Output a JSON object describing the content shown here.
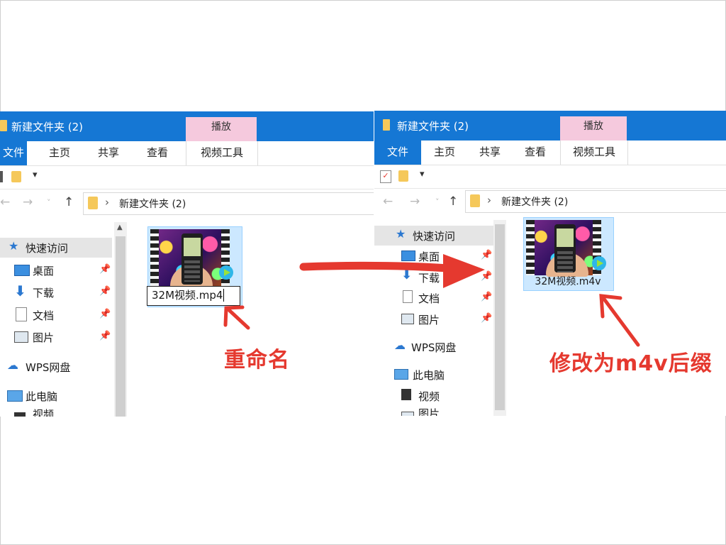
{
  "left_window": {
    "title": "新建文件夹 (2)",
    "context_tab": "播放",
    "ribbon_tabs": [
      "文件",
      "主页",
      "共享",
      "查看",
      "视频工具"
    ],
    "address_path": "新建文件夹 (2)",
    "nav_items": [
      {
        "label": "快速访问",
        "icon": "star-icon"
      },
      {
        "label": "桌面",
        "icon": "desktop-icon",
        "pinned": true
      },
      {
        "label": "下载",
        "icon": "download-icon",
        "pinned": true
      },
      {
        "label": "文档",
        "icon": "document-icon",
        "pinned": true
      },
      {
        "label": "图片",
        "icon": "picture-icon",
        "pinned": true
      },
      {
        "label": "WPS网盘",
        "icon": "cloud-icon"
      },
      {
        "label": "此电脑",
        "icon": "computer-icon"
      },
      {
        "label": "视频",
        "icon": "video-icon"
      }
    ],
    "file": {
      "rename_value": "32M视频.mp4"
    }
  },
  "right_window": {
    "title": "新建文件夹 (2)",
    "context_tab": "播放",
    "ribbon_tabs": [
      "文件",
      "主页",
      "共享",
      "查看",
      "视频工具"
    ],
    "address_path": "新建文件夹 (2)",
    "nav_items": [
      {
        "label": "快速访问",
        "icon": "star-icon"
      },
      {
        "label": "桌面",
        "icon": "desktop-icon",
        "pinned": true
      },
      {
        "label": "下载",
        "icon": "download-icon",
        "pinned": true
      },
      {
        "label": "文档",
        "icon": "document-icon",
        "pinned": true
      },
      {
        "label": "图片",
        "icon": "picture-icon",
        "pinned": true
      },
      {
        "label": "WPS网盘",
        "icon": "cloud-icon"
      },
      {
        "label": "此电脑",
        "icon": "computer-icon"
      },
      {
        "label": "视频",
        "icon": "video-icon"
      },
      {
        "label": "图片",
        "icon": "picture-icon"
      }
    ],
    "file": {
      "name": "32M视频.m4v"
    }
  },
  "annotations": {
    "left": "重命名",
    "right": "修改为m4v后缀"
  },
  "colors": {
    "titlebar": "#1577d4",
    "context_tab": "#f5c9dd",
    "annotation_red": "#e5392f",
    "selection": "#cce8ff"
  }
}
